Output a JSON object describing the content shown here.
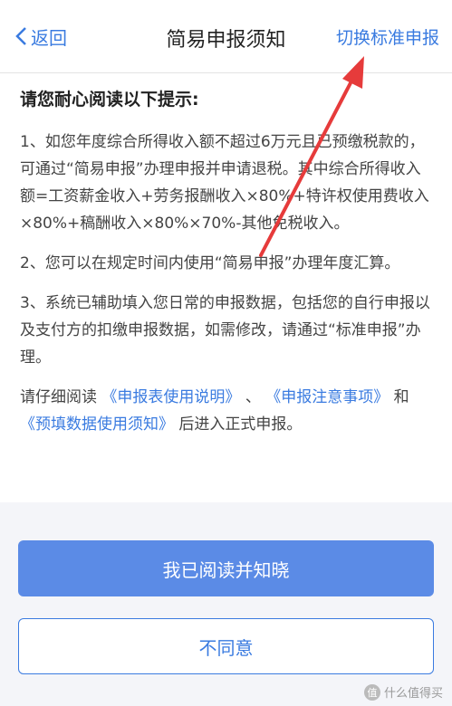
{
  "navbar": {
    "back_label": "返回",
    "title": "简易申报须知",
    "switch_label": "切换标准申报"
  },
  "content": {
    "heading": "请您耐心阅读以下提示:",
    "p1": "1、如您年度综合所得收入额不超过6万元且已预缴税款的，可通过“简易申报”办理申报并申请退税。其中综合所得收入额=工资薪金收入+劳务报酬收入×80%+特许权使用费收入×80%+稿酬收入×80%×70%-其他免税收入。",
    "p2": "2、您可以在规定时间内使用“简易申报”办理年度汇算。",
    "p3": "3、系统已辅助填入您日常的申报数据，包括您的自行申报以及支付方的扣缴申报数据，如需修改，请通过“标准申报”办理。",
    "p4_prefix": "请仔细阅读",
    "link1": "《申报表使用说明》",
    "sep1": "、",
    "link2": "《申报注意事项》",
    "sep2": "和",
    "link3": "《预填数据使用须知》",
    "p4_suffix": "后进入正式申报。"
  },
  "buttons": {
    "agree": "我已阅读并知晓",
    "disagree": "不同意"
  },
  "watermark": {
    "logo": "值",
    "text": "什么值得买"
  },
  "colors": {
    "accent": "#3a7be0",
    "primary_button": "#5b8be6",
    "annotation_arrow": "#e63b3b"
  }
}
